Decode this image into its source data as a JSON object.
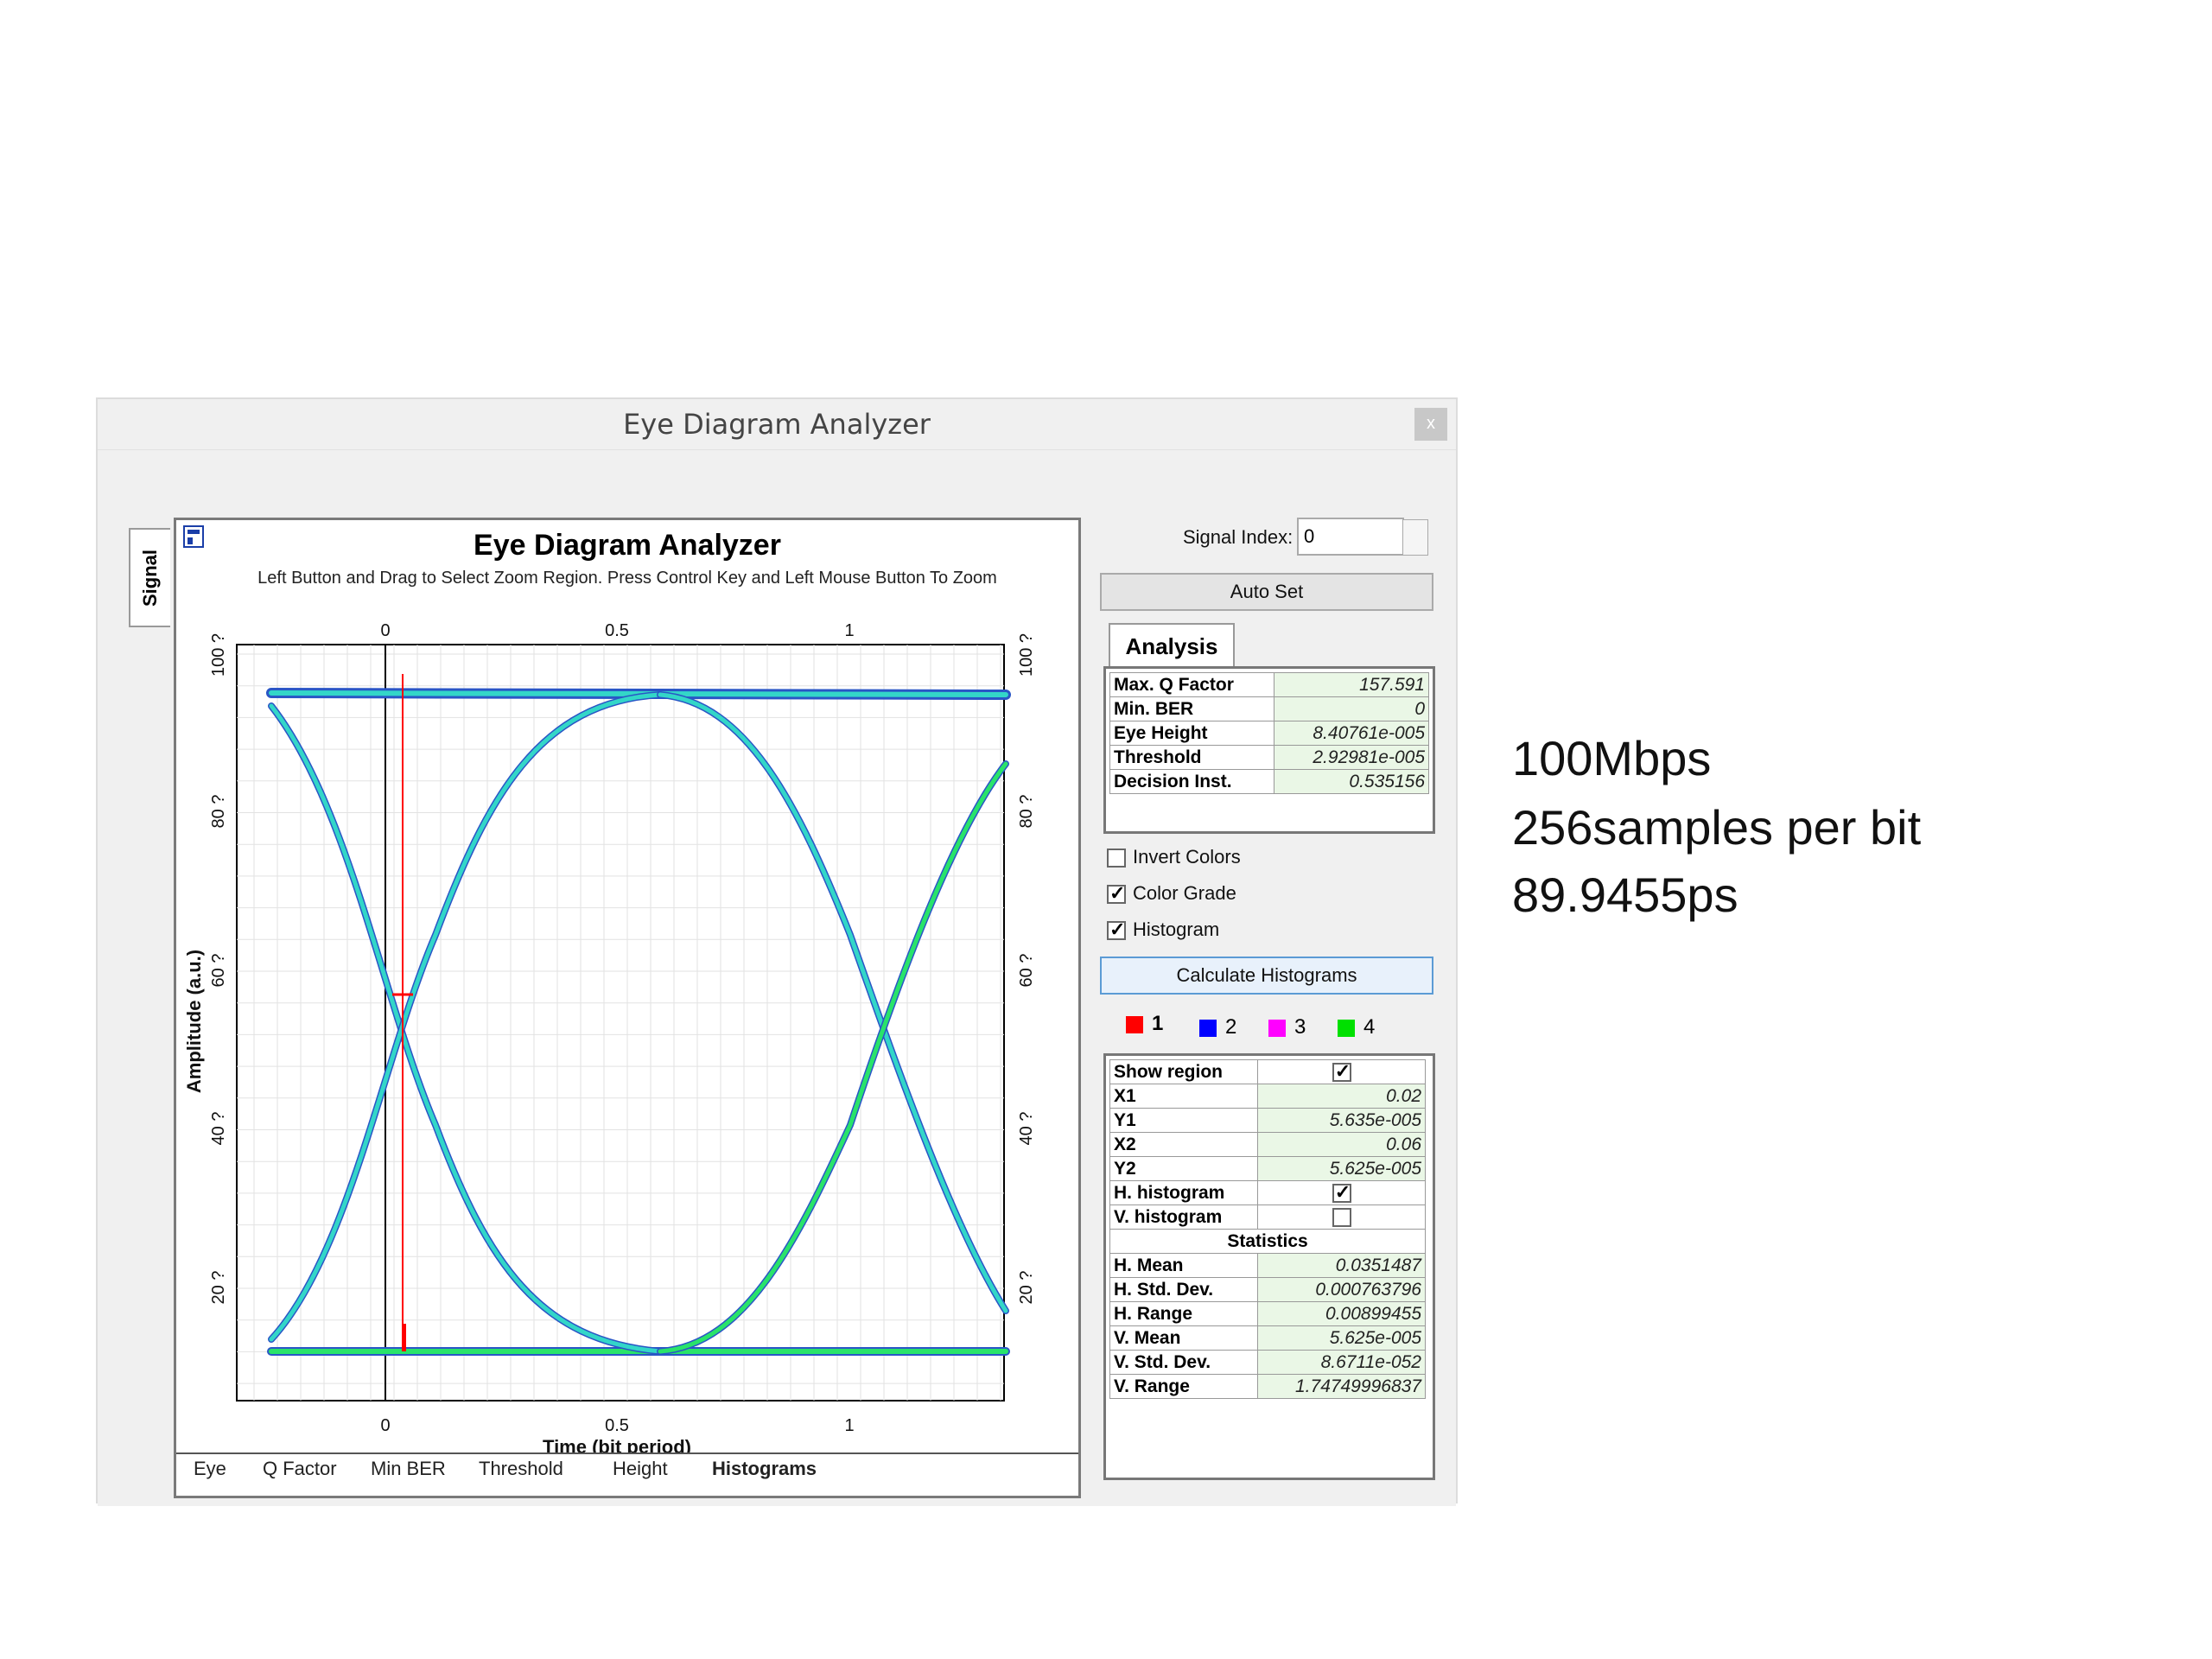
{
  "window": {
    "title": "Eye Diagram Analyzer",
    "close_label": "x"
  },
  "side_tab": {
    "label": "Signal"
  },
  "plot": {
    "title": "Eye Diagram Analyzer",
    "subtitle": "Left Button and Drag to Select Zoom Region. Press Control Key and Left Mouse Button To Zoom",
    "xlabel": "Time (bit period)",
    "ylabel": "Amplitude (a.u.)",
    "x_ticks": [
      "0",
      "0.5",
      "1"
    ],
    "y_ticks": [
      "20 ?",
      "40 ?",
      "60 ?",
      "80 ?",
      "100 ?"
    ],
    "colors": {
      "trace": "#33d6c8",
      "trace_alt": "#29e36a",
      "trace_edge": "#2050c0",
      "marker": "#ff0000"
    }
  },
  "bottom_tabs": [
    "Eye",
    "Q Factor",
    "Min BER",
    "Threshold",
    "Height",
    "Histograms"
  ],
  "controls": {
    "signal_index_label": "Signal Index:",
    "signal_index_value": "0",
    "auto_set": "Auto Set",
    "analysis_tab": "Analysis",
    "invert_colors": "Invert Colors",
    "color_grade": "Color Grade",
    "histogram": "Histogram",
    "calc_histograms": "Calculate Histograms"
  },
  "analysis": [
    {
      "k": "Max. Q Factor",
      "v": "157.591"
    },
    {
      "k": "Min. BER",
      "v": "0"
    },
    {
      "k": "Eye Height",
      "v": "8.40761e-005"
    },
    {
      "k": "Threshold",
      "v": "2.92981e-005"
    },
    {
      "k": "Decision Inst.",
      "v": "0.535156"
    }
  ],
  "num_tabs": [
    {
      "label": "1",
      "color": "#ff0000"
    },
    {
      "label": "2",
      "color": "#0000ff"
    },
    {
      "label": "3",
      "color": "#ff00ff"
    },
    {
      "label": "4",
      "color": "#00e000"
    }
  ],
  "region": {
    "show_region": "Show region",
    "x1": {
      "k": "X1",
      "v": "0.02"
    },
    "y1": {
      "k": "Y1",
      "v": "5.635e-005"
    },
    "x2": {
      "k": "X2",
      "v": "0.06"
    },
    "y2": {
      "k": "Y2",
      "v": "5.625e-005"
    },
    "h_hist": "H. histogram",
    "v_hist": "V. histogram",
    "statistics": "Statistics",
    "stats": [
      {
        "k": "H. Mean",
        "v": "0.0351487"
      },
      {
        "k": "H. Std. Dev.",
        "v": "0.000763796"
      },
      {
        "k": "H. Range",
        "v": "0.00899455"
      },
      {
        "k": "V. Mean",
        "v": "5.625e-005"
      },
      {
        "k": "V. Std. Dev.",
        "v": "8.6711e-052"
      },
      {
        "k": "V. Range",
        "v": "1.74749996837"
      }
    ]
  },
  "side_notes": [
    "100Mbps",
    "256samples per bit",
    "89.9455ps"
  ]
}
